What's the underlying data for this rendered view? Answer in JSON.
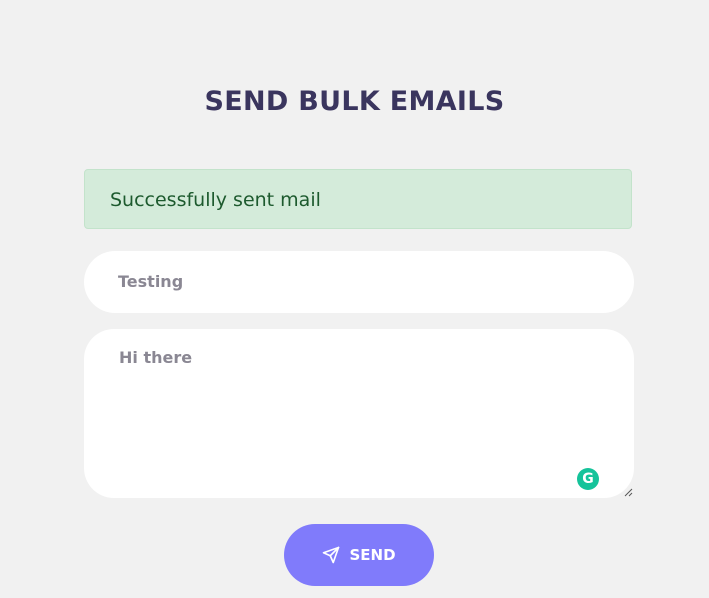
{
  "header": {
    "title": "SEND BULK EMAILS"
  },
  "alert": {
    "text": "Successfully sent mail",
    "status_color": "#d4ebda"
  },
  "form": {
    "subject_value": "Testing",
    "message_value": "Hi there",
    "grammarly_badge": "G",
    "send_label": "SEND",
    "send_icon": "paper-plane-icon",
    "accent_color": "#807bfb"
  }
}
